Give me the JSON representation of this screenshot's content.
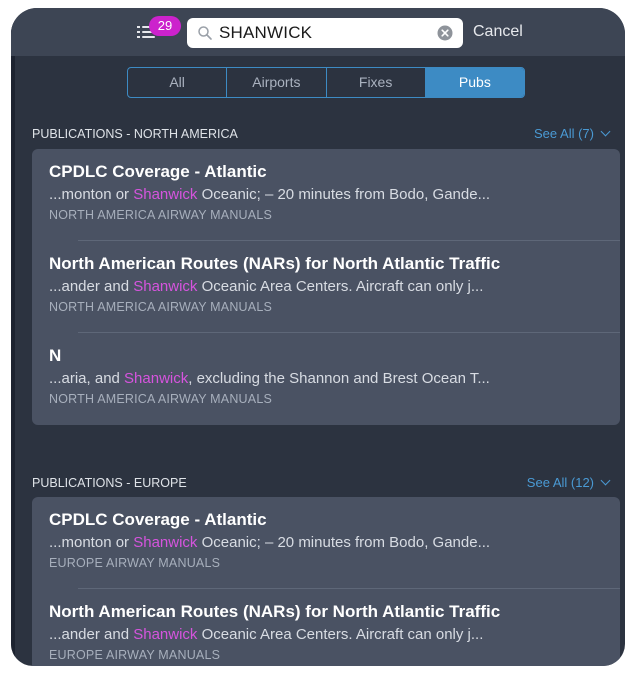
{
  "header": {
    "notification_count": "29",
    "search_value": "SHANWICK",
    "cancel_label": "Cancel"
  },
  "filter_tabs": [
    {
      "label": "All"
    },
    {
      "label": "Airports"
    },
    {
      "label": "Fixes"
    },
    {
      "label": "Pubs",
      "active": true
    }
  ],
  "sections": [
    {
      "title": "PUBLICATIONS - NORTH AMERICA",
      "see_all": "See All (7)",
      "items": [
        {
          "title": "CPDLC Coverage - Atlantic",
          "snippet_pre": "...monton or ",
          "snippet_hl": "Shanwick",
          "snippet_post": " Oceanic; – 20 minutes from Bodo, Gande...",
          "source": "NORTH AMERICA AIRWAY MANUALS"
        },
        {
          "title": "North American Routes (NARs) for North Atlantic Traffic",
          "snippet_pre": "...ander and ",
          "snippet_hl": "Shanwick",
          "snippet_post": " Oceanic Area Centers. Aircraft can only j...",
          "source": "NORTH AMERICA AIRWAY MANUALS"
        },
        {
          "title": "N",
          "snippet_pre": "...aria, and ",
          "snippet_hl": "Shanwick",
          "snippet_post": ", excluding the Shannon and Brest Ocean T...",
          "source": "NORTH AMERICA AIRWAY MANUALS"
        }
      ]
    },
    {
      "title": "PUBLICATIONS - EUROPE",
      "see_all": "See All (12)",
      "items": [
        {
          "title": "CPDLC Coverage - Atlantic",
          "snippet_pre": "...monton or ",
          "snippet_hl": "Shanwick",
          "snippet_post": " Oceanic; – 20 minutes from Bodo, Gande...",
          "source": "EUROPE AIRWAY MANUALS"
        },
        {
          "title": "North American Routes (NARs) for North Atlantic Traffic",
          "snippet_pre": "...ander and ",
          "snippet_hl": "Shanwick",
          "snippet_post": " Oceanic Area Centers. Aircraft can only j...",
          "source": "EUROPE AIRWAY MANUALS"
        }
      ]
    }
  ],
  "icons": {
    "menu": "list-menu-icon",
    "search": "magnifier-icon",
    "clear": "clear-circle-x-icon",
    "see_all": "chevron-down-icon"
  },
  "colors": {
    "background": "#2c3340",
    "header": "#3d4554",
    "card": "#4a5263",
    "accent": "#3d8bc4",
    "highlight": "#d654de",
    "badge": "#cc22cc"
  }
}
